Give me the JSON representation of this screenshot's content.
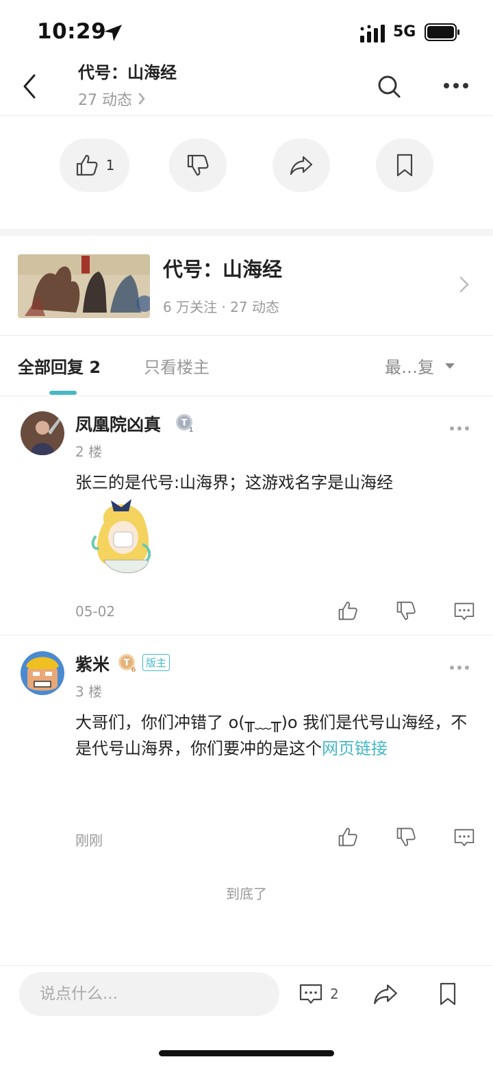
{
  "status_bar": {
    "time": "10:29",
    "network": "5G"
  },
  "header": {
    "title": "代号：山海经",
    "subtitle": "27 动态"
  },
  "actions": {
    "like_count": "1"
  },
  "forum_card": {
    "title": "代号：山海经",
    "stats": "6 万关注 · 27 动态"
  },
  "tabs": {
    "all_replies": "全部回复 2",
    "author_only": "只看楼主",
    "sort_label": "最…复"
  },
  "comments": [
    {
      "username": "凤凰院凶真",
      "level_badge": "T1",
      "floor": "2 楼",
      "text": "张三的是代号:山海界；这游戏名字是山海经",
      "time": "05-02"
    },
    {
      "username": "紫米",
      "level_badge": "T6",
      "role_badge": "版主",
      "floor": "3 楼",
      "text": "大哥们，你们冲错了 o(╥﹏╥)o 我们是代号山海经，不是代号山海界，你们要冲的是这个",
      "link_text": "网页链接",
      "time": "刚刚"
    }
  ],
  "end_text": "到底了",
  "bottom_bar": {
    "input_placeholder": "说点什么...",
    "comment_count": "2"
  },
  "colors": {
    "accent": "#47b8c4",
    "text_primary": "#222222",
    "text_secondary": "#999999",
    "pill_bg": "#f2f2f2"
  }
}
